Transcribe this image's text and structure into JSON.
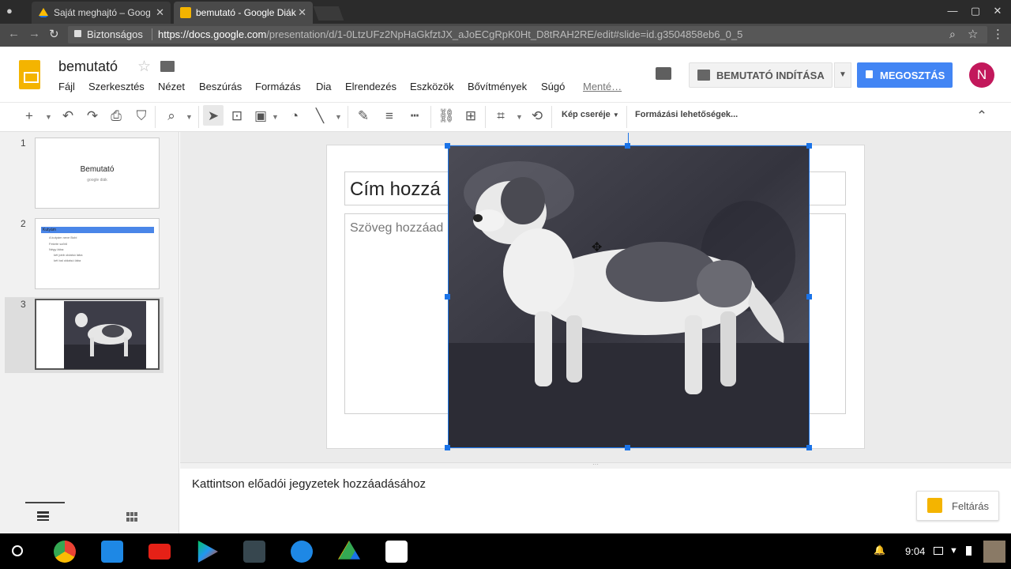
{
  "browser": {
    "tabs": [
      {
        "title": "Saját meghajtó – Google",
        "active": false
      },
      {
        "title": "bemutató - Google Diák",
        "active": true
      }
    ],
    "security_label": "Biztonságos",
    "url_host": "https://docs.google.com",
    "url_path": "/presentation/d/1-0LtzUFz2NpHaGkfztJX_aJoECgRpK0Ht_D8tRAH2RE/edit#slide=id.g3504858eb6_0_5"
  },
  "app": {
    "doc_title": "bemutató",
    "menu": [
      "Fájl",
      "Szerkesztés",
      "Nézet",
      "Beszúrás",
      "Formázás",
      "Dia",
      "Elrendezés",
      "Eszközök",
      "Bővítmények",
      "Súgó"
    ],
    "saving_label": "Menté…",
    "present_label": "BEMUTATÓ INDÍTÁSA",
    "share_label": "MEGOSZTÁS",
    "avatar_initial": "N",
    "brand_color": "#f4b400",
    "share_color": "#4285f4"
  },
  "toolbar": {
    "replace_image_label": "Kép cseréje",
    "format_options_label": "Formázási lehetőségek..."
  },
  "filmstrip": {
    "slides": [
      {
        "number": "1",
        "title": "Bemutató",
        "subtitle": "google diák"
      },
      {
        "number": "2",
        "title": "Kutyám",
        "bullets": [
          "A kutyám neve Bobi",
          "Fekete szőrű",
          "Négy lába:",
          "két jobb oldalsó lába",
          "két bal oldalsó lába"
        ]
      },
      {
        "number": "3"
      }
    ],
    "selected_slide": "3"
  },
  "slide": {
    "title_placeholder": "Cím hozzá",
    "body_placeholder": "Szöveg hozzáad"
  },
  "notes": {
    "placeholder": "Kattintson előadói jegyzetek hozzáadásához"
  },
  "explore": {
    "label": "Feltárás"
  },
  "shelf": {
    "time": "9:04"
  }
}
